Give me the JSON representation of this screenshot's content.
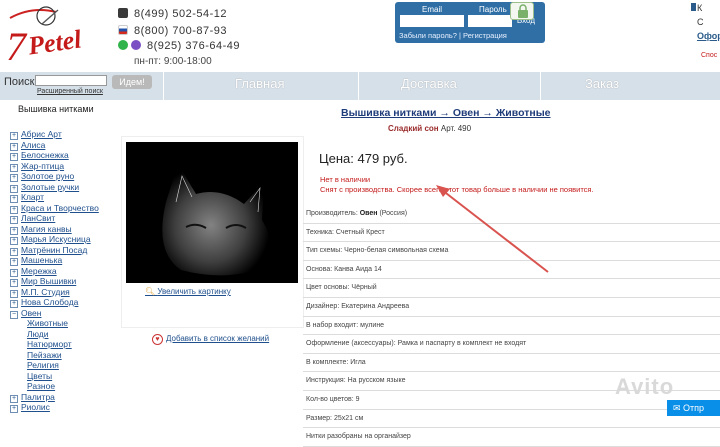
{
  "header": {
    "logo_text": "Petel",
    "logo_seven": "7",
    "phones": [
      "8(499) 502-54-12",
      "8(800) 700-87-93",
      "8(925) 376-64-49"
    ],
    "hours": "пн-пт: 9:00-18:00",
    "login": {
      "email_label": "Email",
      "password_label": "Пароль",
      "enter": "Вход",
      "links": "Забыли пароль? | Регистрация"
    },
    "right_edge": [
      "К",
      "С",
      "Офор",
      "Спос"
    ]
  },
  "nav": {
    "items": [
      "Главная",
      "Доставка",
      "Заказ"
    ]
  },
  "search": {
    "label": "Поиск",
    "button": "Идем!",
    "advanced": "Расширенный поиск"
  },
  "sidebar": {
    "title": "Вышивка нитками",
    "categories": [
      {
        "label": "Абрис Арт",
        "sign": "+"
      },
      {
        "label": "Алиса",
        "sign": "+"
      },
      {
        "label": "Белоснежка",
        "sign": "+"
      },
      {
        "label": "Жар-птица",
        "sign": "+"
      },
      {
        "label": "Золотое руно",
        "sign": "+"
      },
      {
        "label": "Золотые ручки",
        "sign": "+"
      },
      {
        "label": "Кларт",
        "sign": "+"
      },
      {
        "label": "Краса и Творчество",
        "sign": "+"
      },
      {
        "label": "ЛанСвит",
        "sign": "+"
      },
      {
        "label": "Магия канвы",
        "sign": "+"
      },
      {
        "label": "Марья Искусница",
        "sign": "+"
      },
      {
        "label": "Матрёнин Посад",
        "sign": "+"
      },
      {
        "label": "Машенька",
        "sign": "+"
      },
      {
        "label": "Мережка",
        "sign": "+"
      },
      {
        "label": "Мир Вышивки",
        "sign": "+"
      },
      {
        "label": "М.П. Студия",
        "sign": "+"
      },
      {
        "label": "Нова Слобода",
        "sign": "+"
      },
      {
        "label": "Овен",
        "sign": "−"
      }
    ],
    "subcategories": [
      "Животные",
      "Люди",
      "Натюрморт",
      "Пейзажи",
      "Религия",
      "Цветы",
      "Разное"
    ],
    "after": [
      {
        "label": "Палитра",
        "sign": "+"
      },
      {
        "label": "Риолис",
        "sign": "+"
      }
    ]
  },
  "product": {
    "breadcrumb": "Вышивка нитками → Овен → Животные",
    "name": "Сладкий сон",
    "article": "Арт. 490",
    "zoom": "Увеличить картинку",
    "wishlist": "Добавить в список желаний",
    "price": "Цена: 479 руб.",
    "unavailable_1": "Нет в наличии",
    "unavailable_2": "Снят с производства. Скорее всего этот товар больше в наличии не появится.",
    "specs": [
      {
        "k": "Производитель: ",
        "v": "Овен",
        "extra": " (Россия)"
      },
      {
        "k": "Техника: Счетный Крест",
        "v": "",
        "extra": ""
      },
      {
        "k": "Тип схемы: Черно-белая символьная схема",
        "v": "",
        "extra": ""
      },
      {
        "k": "Основа: Канва Аида 14",
        "v": "",
        "extra": ""
      },
      {
        "k": "Цвет основы: Чёрный",
        "v": "",
        "extra": ""
      },
      {
        "k": "Дизайнер: Екатерина Андреева",
        "v": "",
        "extra": ""
      },
      {
        "k": "В набор входит: мулине",
        "v": "",
        "extra": ""
      },
      {
        "k": "Оформление (аксессуары): Рамка и паспарту в комплект не входят",
        "v": "",
        "extra": ""
      },
      {
        "k": "В комплекте: Игла",
        "v": "",
        "extra": ""
      },
      {
        "k": "Инструкция: На русском языке",
        "v": "",
        "extra": ""
      },
      {
        "k": "Кол-во цветов: 9",
        "v": "",
        "extra": ""
      },
      {
        "k": "Размер: 25x21 см",
        "v": "",
        "extra": ""
      },
      {
        "k": "Нитки разобраны на органайзер",
        "v": "",
        "extra": ""
      }
    ]
  },
  "watermark": {
    "text": "Avito",
    "chat": "Отпр"
  },
  "colors": {
    "nav": "#d6e0e9",
    "link": "#1f4f8c",
    "alert": "#c41a1a",
    "login": "#2f6fa6"
  }
}
